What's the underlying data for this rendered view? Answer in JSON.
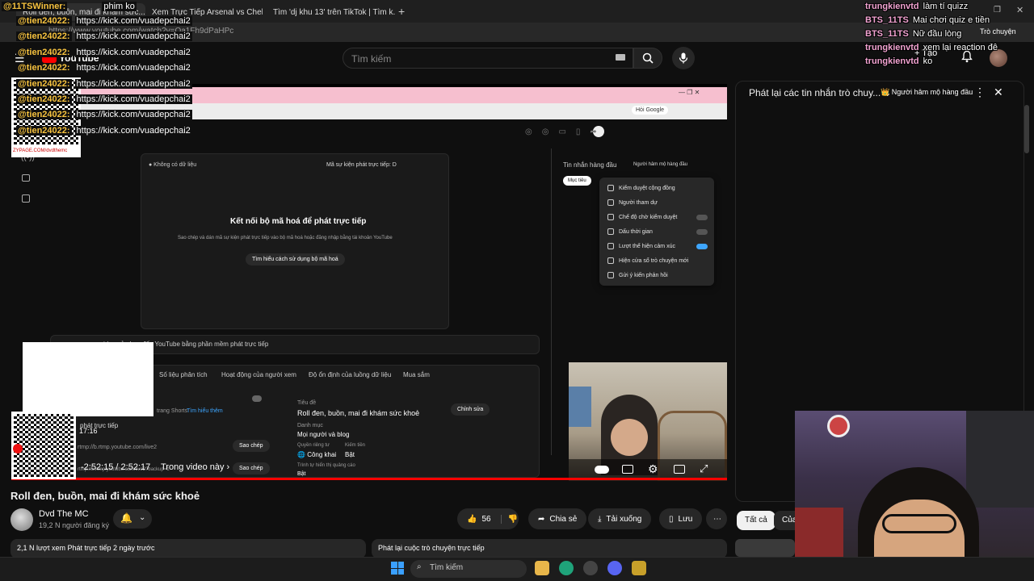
{
  "browser": {
    "tabs": [
      {
        "label": "Roll đen, buồn, mai đi khám sức..."
      },
      {
        "label": "Xem Trực Tiếp Arsenal vs Chelsea"
      },
      {
        "label": "Tìm 'dj khu 13' trên TikTok | Tìm k..."
      }
    ],
    "new_tab": "+",
    "address": "https://www.youtube.com/watch?v=Oa1Fh9dPaHPc"
  },
  "yt": {
    "logo": "YouTube",
    "search_placeholder": "Tìm kiếm",
    "create_label": "+ Tạo"
  },
  "chat_overlay": [
    {
      "user": "trungkienvtd",
      "msg": "làm tí quizz"
    },
    {
      "user": "BTS_11TS",
      "msg": "Mai chơi quiz e tiền"
    },
    {
      "user": "BTS_11TS",
      "msg": "Nữ đầu lòng"
    },
    {
      "user": "trungkienvtd",
      "msg": "xem lại reaction đê"
    },
    {
      "user": "trungkienvtd",
      "msg": "ko"
    }
  ],
  "chat_overlay_top_right": "Trò chuyện",
  "spam": {
    "first_user": "@11TSWinner:",
    "first_msg": "phim ko",
    "user": "@tien24022:",
    "link": "https://kick.com/vuadepchai2",
    "count": 8
  },
  "overlay_footer": "ZYPAGE.COM/dvdthemc",
  "player": {
    "inner_title": "Kết nối bộ mã hoá để phát trực tiếp",
    "inner_desc": "Sao chép và dán mã sự kiện phát trực tiếp vào bộ mã hoá hoặc đăng nhập bằng tài khoản YouTube",
    "inner_button": "Tìm hiểu cách sử dụng bộ mã hoá",
    "no_data": "● Không có dữ liệu",
    "event_code": "Mã sự kiện phát trực tiếp: D",
    "hint": "video của bạn đến YouTube bằng phần mềm phát trực tiếp",
    "tabs": [
      "Số liệu phân tích",
      "Hoạt động của người xem",
      "Độ ổn định của luồng dữ liệu",
      "Mua sắm"
    ],
    "shorts_note": "trang Shorts",
    "learn_more": "Tìm hiểu thêm",
    "stream_title_label": "Tiêu đề",
    "stream_title": "Roll đen, buồn, mai đi khám sức khoẻ",
    "edit": "Chỉnh sửa",
    "category_label": "Danh mục",
    "category": "Mọi người và blog",
    "privacy_label": "Quyền riêng tư",
    "privacy": "Công khai",
    "monetize_label": "Kiếm tiền",
    "monetize": "Bật",
    "ad_label": "Trình tự hiển thị quảng cáo",
    "ad_value": "Bật",
    "copy1": "Sao chép",
    "copy2": "Sao chép",
    "rtmp1": "rtmp://b.rtmp.youtube.com/live2",
    "rtmp2": "rtmp://b.rtmp.youtube.com/live2?backup=1",
    "stream_label": "phát trực tiếp",
    "time_small": "17:16",
    "time": "-2:52:15 / 2:52:17",
    "chapter": "Trong video này",
    "inner_chat_title": "Tin nhắn hàng đầu",
    "inner_member": "Người hâm mộ hàng đầu",
    "inner_chip": "Mục tiêu",
    "menu": [
      "Kiểm duyệt cộng đồng",
      "Người tham dự",
      "Chế độ chờ kiểm duyệt",
      "Dấu thời gian",
      "Lượt thể hiện cảm xúc",
      "Hiện cửa sổ trò chuyện mới",
      "Gửi ý kiến phản hồi"
    ]
  },
  "chat_panel": {
    "title": "Phát lại các tin nhắn trò chuy...",
    "badge": "Người hâm mộ hàng đầu"
  },
  "video": {
    "title": "Roll đen, buồn, mai đi khám sức khoẻ",
    "channel": "Dvd The MC",
    "subs": "19,2 N người đăng ký",
    "likes": "56",
    "share": "Chia sẻ",
    "download": "Tải xuống",
    "save": "Lưu",
    "views": "2,1 N lượt xem  Phát trực tiếp 2 ngày trước",
    "replay": "Phát lại cuộc trò chuyện trực tiếp",
    "chip_all": "Tất cả",
    "chip_of": "Của"
  },
  "taskbar": {
    "search": "Tìm kiếm"
  }
}
